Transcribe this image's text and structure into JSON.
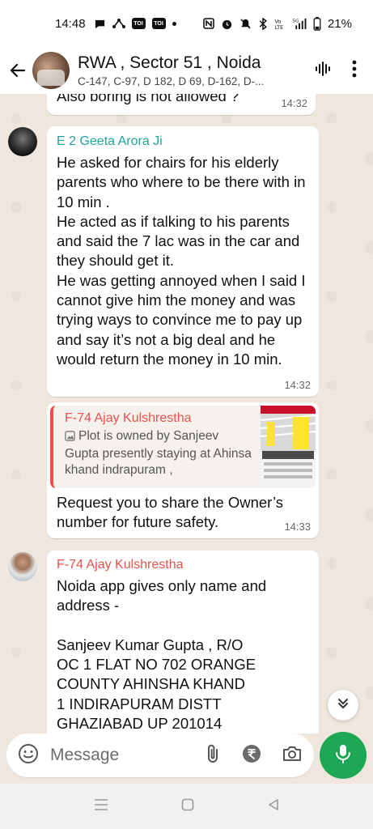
{
  "status_bar": {
    "time": "14:48",
    "toi_1": "TOI",
    "toi_2": "TOI",
    "battery": "21%",
    "network": "5G"
  },
  "header": {
    "title": "RWA , Sector 51 , Noida",
    "subtitle": "C-147, C-97, D 182, D 69, D-162, D-..."
  },
  "messages": [
    {
      "text": "Also boring is not allowed ?",
      "time": "14:32"
    },
    {
      "sender": "E 2 Geeta Arora Ji",
      "sender_color": "#1fa39a",
      "text": "He asked for chairs for his elderly parents who where to be there with in 10 min .\nHe acted as if talking to his parents and said the 7 lac was in the car and they should get it.\nHe was getting annoyed when I said I cannot give him the money and was trying ways to convince me to pay up and say it’s not a big deal and he would return the money in 10 min.",
      "time": "14:32"
    },
    {
      "quote": {
        "sender": "F-74 Ajay Kulshrestha",
        "text": "Plot is owned by Sanjeev Gupta presently staying at Ahinsa khand indrapuram ,"
      },
      "text": "Request you to share the Owner’s number for future safety.",
      "time": "14:33"
    },
    {
      "sender": "F-74 Ajay Kulshrestha",
      "sender_color": "#e5534b",
      "text": "Noida app gives only name and address -\n\nSanjeev Kumar Gupta , R/O\nOC 1 FLAT NO 702 ORANGE COUNTY AHINSHA KHAND\n1 INDIRAPURAM DISTT\nGHAZIABAD UP 201014"
    }
  ],
  "input": {
    "placeholder": "Message"
  },
  "colors": {
    "accent_green": "#1da856",
    "chat_bg": "#efe7dd",
    "quote_red": "#e5534b",
    "sender_teal": "#1fa39a"
  }
}
